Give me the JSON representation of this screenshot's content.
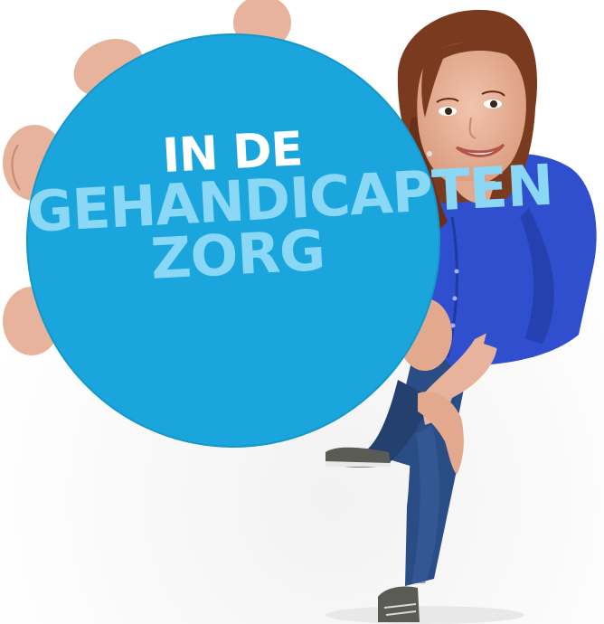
{
  "badge": {
    "line1": "IN DE",
    "line2": "GEHANDICAPTEN",
    "line3": "ZORG"
  },
  "colors": {
    "badge_fill": "#1aa6dd",
    "accent_text": "#8ad8f6",
    "primary_text": "#ffffff",
    "shirt": "#2f4fcf",
    "jeans": "#2b4d86",
    "skin": "#e7b39c",
    "hair": "#7a3a20",
    "shoe": "#5b5b55"
  },
  "icons": [
    "round-badge-icon"
  ]
}
